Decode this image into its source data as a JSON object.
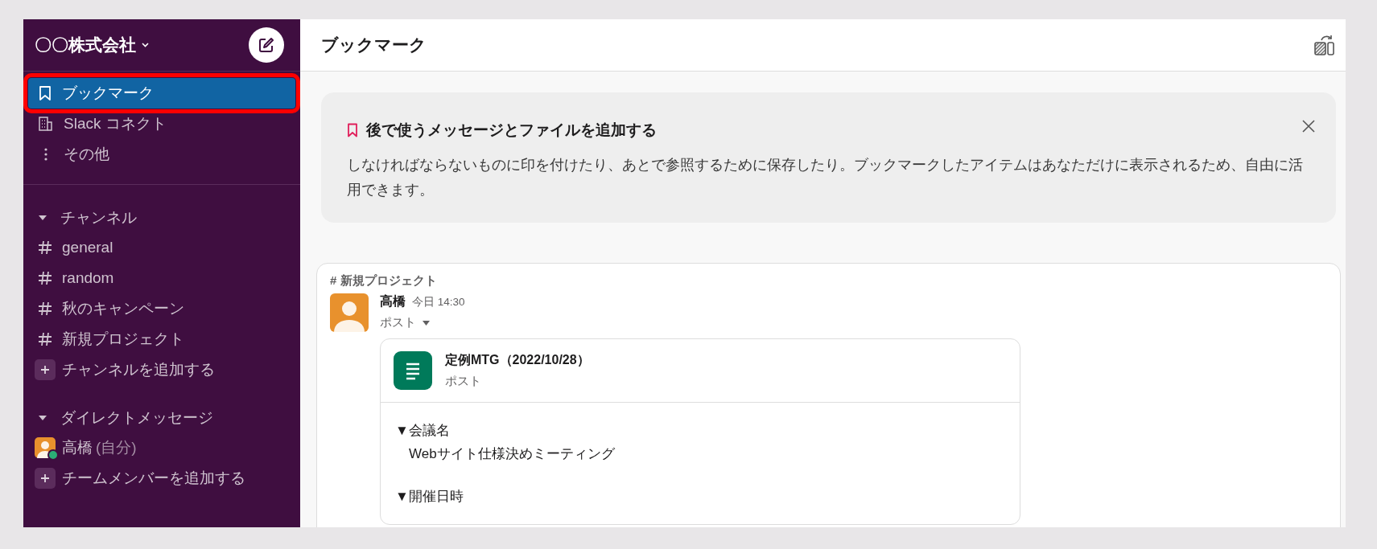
{
  "workspace": {
    "name": "〇〇株式会社"
  },
  "sidebar": {
    "nav": [
      {
        "label": "ブックマーク",
        "kind": "bookmark",
        "selected": true,
        "highlighted": true
      },
      {
        "label": "Slack コネクト",
        "kind": "building",
        "selected": false,
        "highlighted": false
      },
      {
        "label": "その他",
        "kind": "more",
        "selected": false,
        "highlighted": false
      }
    ],
    "sections": [
      {
        "title": "チャンネル",
        "expanded": true,
        "items": [
          {
            "kind": "channel",
            "label": "general"
          },
          {
            "kind": "channel",
            "label": "random"
          },
          {
            "kind": "channel",
            "label": "秋のキャンペーン"
          },
          {
            "kind": "channel",
            "label": "新規プロジェクト"
          },
          {
            "kind": "add",
            "label": "チャンネルを追加する"
          }
        ]
      },
      {
        "title": "ダイレクトメッセージ",
        "expanded": true,
        "items": [
          {
            "kind": "dm",
            "label": "高橋",
            "note": "(自分)",
            "online": true
          },
          {
            "kind": "add",
            "label": "チームメンバーを追加する"
          }
        ]
      }
    ]
  },
  "header": {
    "title": "ブックマーク"
  },
  "banner": {
    "title": "後で使うメッセージとファイルを追加する",
    "body": "しなければならないものに印を付けたり、あとで参照するために保存したり。ブックマークしたアイテムはあなただけに表示されるため、自由に活用できます。"
  },
  "bookmarks": [
    {
      "channel": "# 新規プロジェクト",
      "author": "高橋",
      "time": "今日 14:30",
      "type_label": "ポスト",
      "attachment": {
        "title": "定例MTG（2022/10/28）",
        "subtitle": "ポスト",
        "sections": [
          {
            "heading": "▼会議名",
            "value": "Webサイト仕様決めミーティング"
          },
          {
            "heading": "▼開催日時"
          }
        ]
      }
    }
  ]
}
